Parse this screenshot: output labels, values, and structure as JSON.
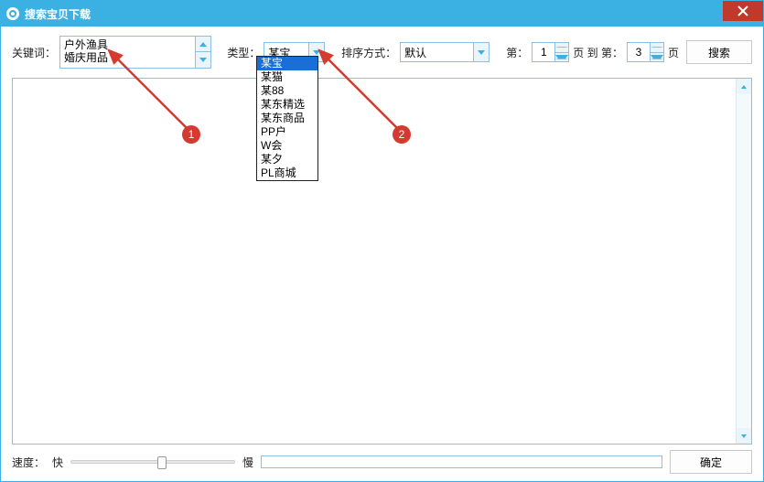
{
  "window": {
    "title": "搜索宝贝下载"
  },
  "toolbar": {
    "keyword_label": "关键词：",
    "keyword_lines": [
      "户外渔具",
      "婚庆用品"
    ],
    "type_label": "类型：",
    "type_value": "某宝",
    "type_options": [
      "某宝",
      "某猫",
      "某88",
      "某东精选",
      "某东商品",
      "PP户",
      "W会",
      "某夕",
      "PL商城"
    ],
    "sort_label": "排序方式：",
    "sort_value": "默认",
    "page_prefix": "第：",
    "page_from": "1",
    "page_mid": "页 到 第：",
    "page_to": "3",
    "page_suffix": "页",
    "search_label": "搜索"
  },
  "footer": {
    "speed_label": "速度：",
    "fast_label": "快",
    "slow_label": "慢",
    "slider_pos_percent": 55,
    "ok_label": "确定"
  },
  "annotations": {
    "badge1": "1",
    "badge2": "2"
  },
  "colors": {
    "accent": "#3bb0e2",
    "close": "#c0392b",
    "badge": "#d43a2f",
    "select": "#1a6fd6"
  }
}
